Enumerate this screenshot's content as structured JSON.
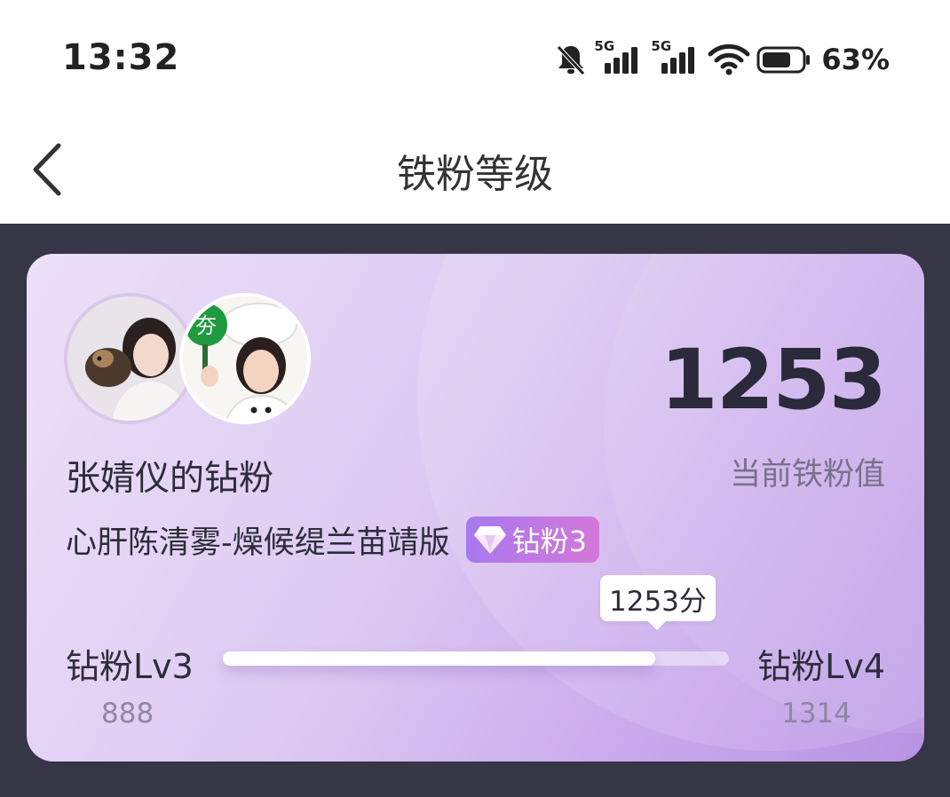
{
  "status_bar": {
    "time": "13:32",
    "network_1": "5G",
    "network_2": "5G",
    "battery_percent": "63%",
    "icons": [
      "bell-muted-icon",
      "signal-5g-icon",
      "signal-5g-icon",
      "wifi-icon",
      "battery-icon"
    ]
  },
  "nav": {
    "title": "铁粉等级",
    "back_icon": "chevron-left-icon"
  },
  "card": {
    "fan_title": "张婧仪的钻粉",
    "subtitle": "心肝陈清雾-燥候缇兰苗靖版",
    "badge": {
      "icon": "diamond-icon",
      "label": "钻粉3"
    },
    "score_value": "1253",
    "score_label": "当前铁粉值",
    "progress": {
      "tooltip": "1253分",
      "current_level": "钻粉Lv3",
      "next_level": "钻粉Lv4",
      "min": "888",
      "max": "1314",
      "current": 1253,
      "min_num": 888,
      "max_num": 1314,
      "fill_fraction": 0.855
    }
  },
  "colors": {
    "content_bg": "#363646",
    "badge_start": "#a879f0",
    "badge_end": "#d477d8",
    "card_accent": "#b893e4"
  }
}
